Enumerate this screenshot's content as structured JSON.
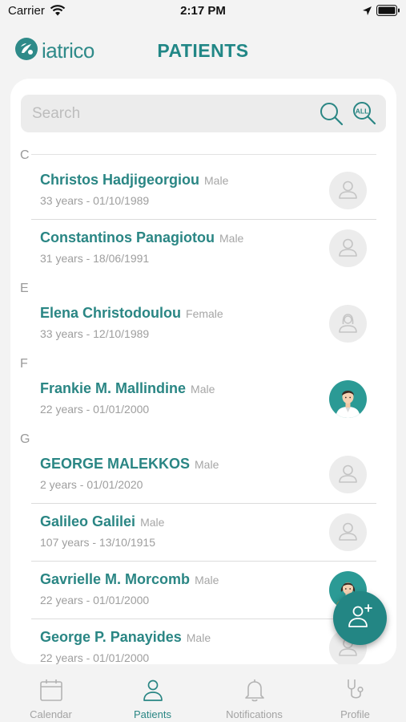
{
  "status_bar": {
    "carrier": "Carrier",
    "time": "2:17 PM"
  },
  "header": {
    "logo_text": "iatrico",
    "title": "PATIENTS"
  },
  "search": {
    "placeholder": "Search"
  },
  "sections": [
    {
      "letter": "C",
      "patients": [
        {
          "name": "Christos Hadjigeorgiou",
          "gender": "Male",
          "meta": "33 years - 01/10/1989",
          "avatar": "placeholder-male"
        },
        {
          "name": "Constantinos Panagiotou",
          "gender": "Male",
          "meta": "31 years - 18/06/1991",
          "avatar": "placeholder-male"
        }
      ]
    },
    {
      "letter": "E",
      "patients": [
        {
          "name": "Elena Christodoulou",
          "gender": "Female",
          "meta": "33 years - 12/10/1989",
          "avatar": "placeholder-female"
        }
      ]
    },
    {
      "letter": "F",
      "patients": [
        {
          "name": "Frankie M. Mallindine",
          "gender": "Male",
          "meta": "22 years - 01/01/2000",
          "avatar": "photo-male"
        }
      ]
    },
    {
      "letter": "G",
      "patients": [
        {
          "name": "GEORGE MALEKKOS",
          "gender": "Male",
          "meta": "2 years - 01/01/2020",
          "avatar": "placeholder-male"
        },
        {
          "name": "Galileo Galilei",
          "gender": "Male",
          "meta": "107 years - 13/10/1915",
          "avatar": "placeholder-male"
        },
        {
          "name": "Gavrielle M. Morcomb",
          "gender": "Male",
          "meta": "22 years - 01/01/2000",
          "avatar": "photo-female"
        },
        {
          "name": "George P. Panayides",
          "gender": "Male",
          "meta": "22 years - 01/01/2000",
          "avatar": "placeholder-male"
        }
      ]
    }
  ],
  "tabs": [
    {
      "label": "Calendar",
      "icon": "calendar-icon",
      "active": false
    },
    {
      "label": "Patients",
      "icon": "patient-icon",
      "active": true
    },
    {
      "label": "Notifications",
      "icon": "bell-icon",
      "active": false
    },
    {
      "label": "Profile",
      "icon": "stethoscope-icon",
      "active": false
    }
  ],
  "colors": {
    "accent": "#2a8684",
    "background": "#f3f3f3",
    "card": "#ffffff"
  }
}
